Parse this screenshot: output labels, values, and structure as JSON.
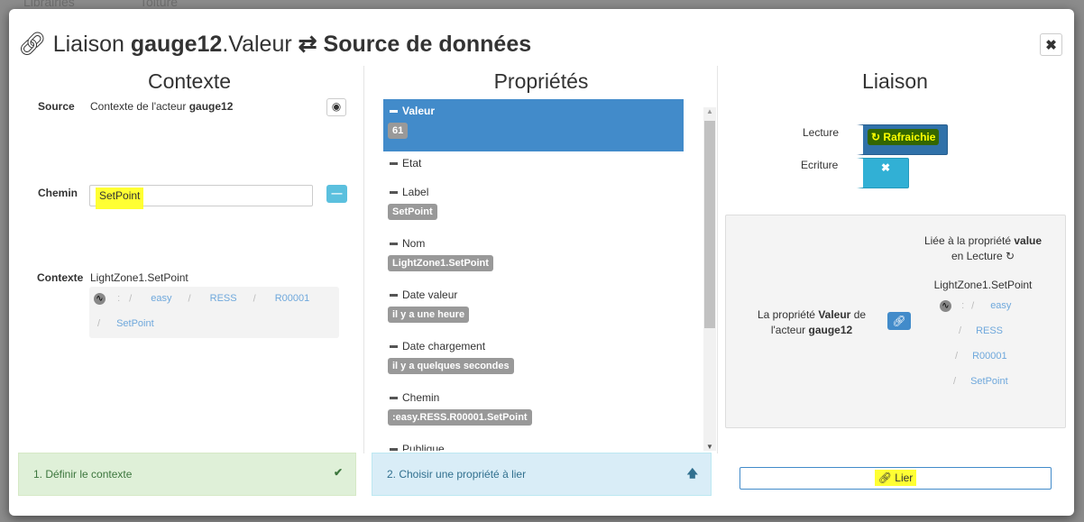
{
  "background": {
    "librairies": "Librairies",
    "toiture": "Toiture"
  },
  "modal": {
    "title": {
      "prefix": "Liaison ",
      "actor": "gauge12",
      "prop": ".Valeur",
      "target": "Source de données"
    },
    "close_label": "✖"
  },
  "contexte": {
    "heading": "Contexte",
    "source_label": "Source",
    "source_text": "Contexte de l'acteur ",
    "source_actor": "gauge12",
    "chemin_label": "Chemin",
    "chemin_value": "SetPoint",
    "contexte_label": "Contexte",
    "contexte_value": "LightZone1.SetPoint",
    "path": [
      ":",
      "easy",
      "RESS",
      "R00001",
      "SetPoint"
    ]
  },
  "proprietes": {
    "heading": "Propriétés",
    "items": [
      {
        "name": "Valeur",
        "value": "61"
      },
      {
        "name": "Etat",
        "value": null
      },
      {
        "name": "Label",
        "value": "SetPoint"
      },
      {
        "name": "Nom",
        "value": "LightZone1.SetPoint"
      },
      {
        "name": "Date valeur",
        "value": "il y a une heure"
      },
      {
        "name": "Date chargement",
        "value": "il y a quelques secondes"
      },
      {
        "name": "Chemin",
        "value": ":easy.RESS.R00001.SetPoint"
      },
      {
        "name": "Publique",
        "value": null
      }
    ]
  },
  "liaison": {
    "heading": "Liaison",
    "lecture_label": "Lecture",
    "lecture_button": "Rafraichie",
    "ecriture_label": "Ecriture",
    "ecriture_button": "✖",
    "summary": {
      "left_pre": "La propriété ",
      "left_prop": "Valeur",
      "left_mid": " de l'acteur ",
      "left_actor": "gauge12",
      "right_pre": "Liée à la propriété ",
      "right_prop": "value",
      "right_mode": "en Lecture",
      "right_path_title": "LightZone1.SetPoint",
      "path": [
        ":",
        "easy",
        "RESS",
        "R00001",
        "SetPoint"
      ]
    }
  },
  "steps": {
    "step1": "1. Définir le contexte",
    "step2": "2. Choisir une propriété à lier",
    "lier": "Lier"
  },
  "colors": {
    "primary": "#428bca",
    "info": "#31b0d5",
    "success_bg": "#dff0d8",
    "info_bg": "#d9edf7"
  }
}
